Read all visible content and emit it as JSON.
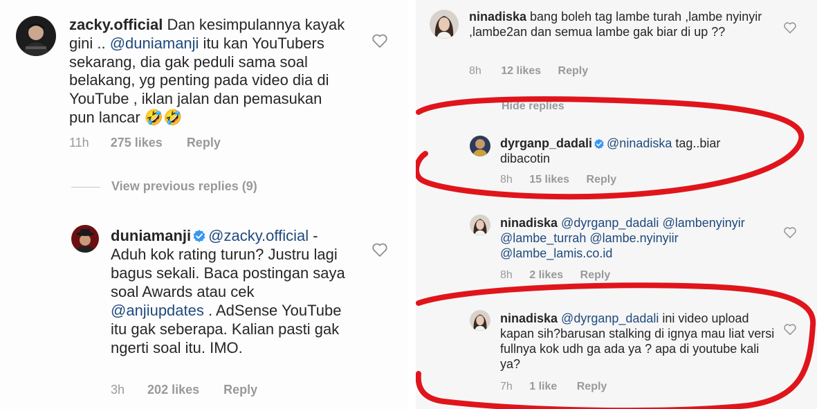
{
  "left": {
    "comment1": {
      "username": "zacky.official",
      "text_before": " Dan kesimpulannya kayak gini .. ",
      "mention": "@duniamanji",
      "text_after": " itu kan YouTubers sekarang, dia gak peduli sama soal belakang, yg penting pada video dia di YouTube , iklan jalan dan pemasukan pun lancar ",
      "emoji": "🤣🤣",
      "time": "11h",
      "likes": "275 likes",
      "reply": "Reply"
    },
    "view_previous": "View previous replies (9)",
    "comment2": {
      "username": "duniamanji",
      "mention1": "@zacky.official",
      "text1": " - Aduh kok rating turun? Justru lagi bagus sekali. Baca postingan saya soal Awards atau cek ",
      "mention2": "@anjiupdates",
      "text2": " . AdSense YouTube itu gak seberapa. Kalian pasti gak ngerti soal itu. IMO.",
      "time": "3h",
      "likes": "202 likes",
      "reply": "Reply"
    }
  },
  "right": {
    "comment1": {
      "username": "ninadiska",
      "text": " bang boleh tag lambe turah ,lambe nyinyir ,lambe2an dan semua lambe gak biar di up ??",
      "time": "8h",
      "likes": "12 likes",
      "reply": "Reply"
    },
    "hide_replies": "Hide replies",
    "comment2": {
      "username": "dyrganp_dadali",
      "mention": "@ninadiska",
      "text": " tag..biar dibacotin",
      "time": "8h",
      "likes": "15 likes",
      "reply": "Reply"
    },
    "comment3": {
      "username": "ninadiska",
      "mention1": "@dyrganp_dadali",
      "mention2": "@lambenyinyir",
      "mention3": "@lambe_turrah",
      "mention4": "@lambe.nyinyiir",
      "mention5": "@lambe_lamis.co.id",
      "time": "8h",
      "likes": "2 likes",
      "reply": "Reply"
    },
    "comment4": {
      "username": "ninadiska",
      "mention": "@dyrganp_dadali",
      "text": " ini video upload kapan sih?barusan stalking di ignya mau liat versi fullnya kok udh ga ada ya ? apa di youtube kali ya?",
      "time": "7h",
      "likes": "1 like",
      "reply": "Reply"
    }
  },
  "colors": {
    "mention": "#1e4a7d",
    "meta": "#999999",
    "verified": "#3897f0",
    "annotation": "#e0151b"
  }
}
